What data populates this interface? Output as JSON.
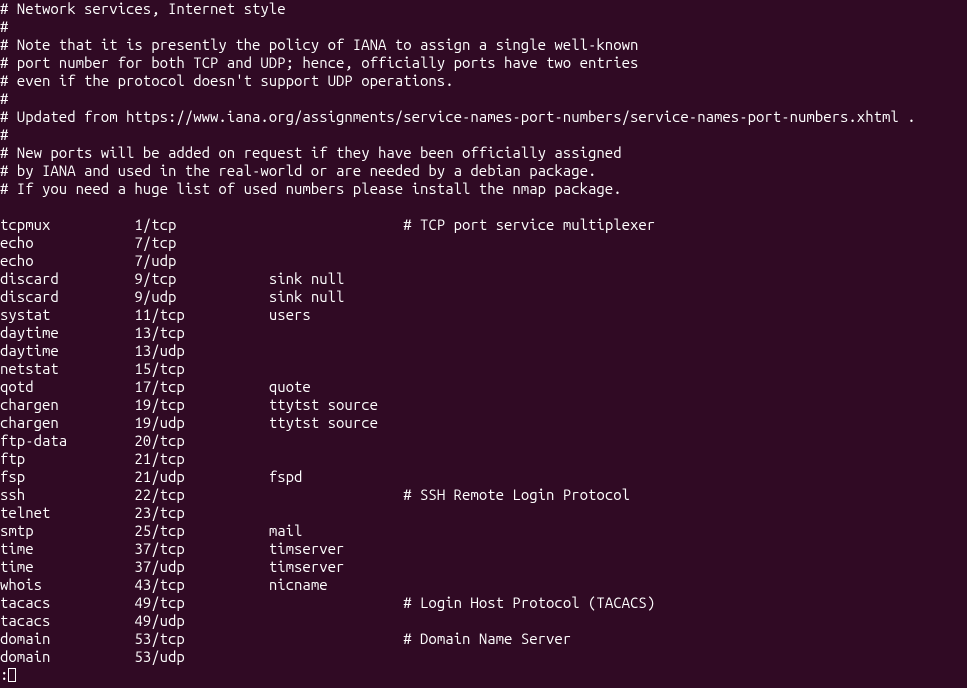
{
  "header_comments": [
    "# Network services, Internet style",
    "#",
    "# Note that it is presently the policy of IANA to assign a single well-known",
    "# port number for both TCP and UDP; hence, officially ports have two entries",
    "# even if the protocol doesn't support UDP operations.",
    "#",
    "# Updated from https://www.iana.org/assignments/service-names-port-numbers/service-names-port-numbers.xhtml .",
    "#",
    "# New ports will be added on request if they have been officially assigned",
    "# by IANA and used in the real-world or are needed by a debian package.",
    "# If you need a huge list of used numbers please install the nmap package.",
    ""
  ],
  "services": [
    {
      "name": "tcpmux",
      "port": "1/tcp",
      "aliases": "",
      "comment": "# TCP port service multiplexer"
    },
    {
      "name": "echo",
      "port": "7/tcp",
      "aliases": "",
      "comment": ""
    },
    {
      "name": "echo",
      "port": "7/udp",
      "aliases": "",
      "comment": ""
    },
    {
      "name": "discard",
      "port": "9/tcp",
      "aliases": "sink null",
      "comment": ""
    },
    {
      "name": "discard",
      "port": "9/udp",
      "aliases": "sink null",
      "comment": ""
    },
    {
      "name": "systat",
      "port": "11/tcp",
      "aliases": "users",
      "comment": ""
    },
    {
      "name": "daytime",
      "port": "13/tcp",
      "aliases": "",
      "comment": ""
    },
    {
      "name": "daytime",
      "port": "13/udp",
      "aliases": "",
      "comment": ""
    },
    {
      "name": "netstat",
      "port": "15/tcp",
      "aliases": "",
      "comment": ""
    },
    {
      "name": "qotd",
      "port": "17/tcp",
      "aliases": "quote",
      "comment": ""
    },
    {
      "name": "chargen",
      "port": "19/tcp",
      "aliases": "ttytst source",
      "comment": ""
    },
    {
      "name": "chargen",
      "port": "19/udp",
      "aliases": "ttytst source",
      "comment": ""
    },
    {
      "name": "ftp-data",
      "port": "20/tcp",
      "aliases": "",
      "comment": ""
    },
    {
      "name": "ftp",
      "port": "21/tcp",
      "aliases": "",
      "comment": ""
    },
    {
      "name": "fsp",
      "port": "21/udp",
      "aliases": "fspd",
      "comment": ""
    },
    {
      "name": "ssh",
      "port": "22/tcp",
      "aliases": "",
      "comment": "# SSH Remote Login Protocol"
    },
    {
      "name": "telnet",
      "port": "23/tcp",
      "aliases": "",
      "comment": ""
    },
    {
      "name": "smtp",
      "port": "25/tcp",
      "aliases": "mail",
      "comment": ""
    },
    {
      "name": "time",
      "port": "37/tcp",
      "aliases": "timserver",
      "comment": ""
    },
    {
      "name": "time",
      "port": "37/udp",
      "aliases": "timserver",
      "comment": ""
    },
    {
      "name": "whois",
      "port": "43/tcp",
      "aliases": "nicname",
      "comment": ""
    },
    {
      "name": "tacacs",
      "port": "49/tcp",
      "aliases": "",
      "comment": "# Login Host Protocol (TACACS)"
    },
    {
      "name": "tacacs",
      "port": "49/udp",
      "aliases": "",
      "comment": ""
    },
    {
      "name": "domain",
      "port": "53/tcp",
      "aliases": "",
      "comment": "# Domain Name Server"
    },
    {
      "name": "domain",
      "port": "53/udp",
      "aliases": "",
      "comment": ""
    }
  ],
  "prompt": ":",
  "columns": {
    "name_width": 16,
    "port_width": 16,
    "aliases_width": 16
  }
}
